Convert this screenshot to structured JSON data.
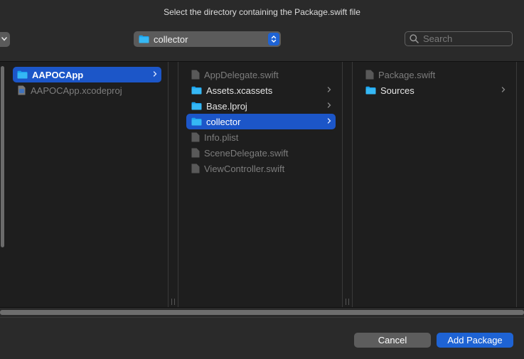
{
  "dialog": {
    "title": "Select the directory containing the Package.swift file"
  },
  "toolbar": {
    "path_popup_label": "collector",
    "search_placeholder": "Search"
  },
  "columns": [
    {
      "items": [
        {
          "name": "AAPOCApp",
          "type": "folder",
          "selected": true,
          "has_children": true
        },
        {
          "name": "AAPOCApp.xcodeproj",
          "type": "xcodeproj",
          "dimmed": true
        }
      ]
    },
    {
      "items": [
        {
          "name": "AppDelegate.swift",
          "type": "file",
          "dimmed": true
        },
        {
          "name": "Assets.xcassets",
          "type": "folder",
          "has_children": true
        },
        {
          "name": "Base.lproj",
          "type": "folder",
          "has_children": true
        },
        {
          "name": "collector",
          "type": "folder",
          "selected": true,
          "has_children": true
        },
        {
          "name": "Info.plist",
          "type": "file",
          "dimmed": true
        },
        {
          "name": "SceneDelegate.swift",
          "type": "file",
          "dimmed": true
        },
        {
          "name": "ViewController.swift",
          "type": "file",
          "dimmed": true
        }
      ]
    },
    {
      "items": [
        {
          "name": "Package.swift",
          "type": "file",
          "dimmed": true
        },
        {
          "name": "Sources",
          "type": "folder",
          "has_children": true
        }
      ]
    }
  ],
  "footer": {
    "cancel_label": "Cancel",
    "add_label": "Add Package"
  },
  "colors": {
    "accent": "#1e63d4",
    "selection": "#1c56c8",
    "folder": "#1aa3ee"
  }
}
